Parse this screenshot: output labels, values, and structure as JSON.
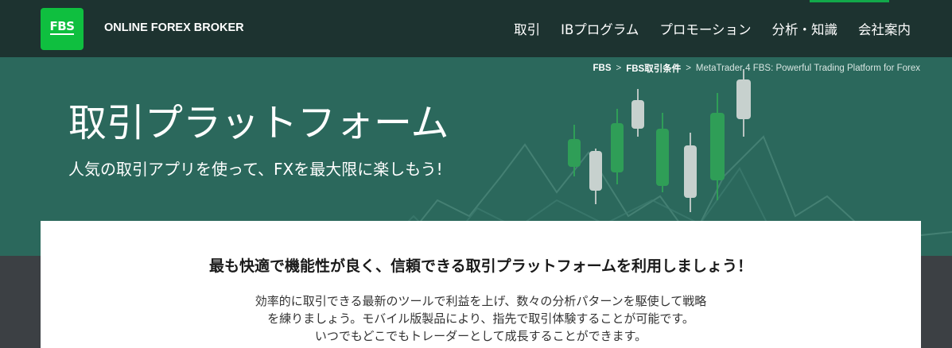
{
  "header": {
    "logo_text": "FBS",
    "brand": "ONLINE FOREX BROKER",
    "nav": [
      {
        "label": "取引"
      },
      {
        "label": "IBプログラム"
      },
      {
        "label": "プロモーション"
      },
      {
        "label": "分析・知識"
      },
      {
        "label": "会社案内"
      }
    ]
  },
  "breadcrumb": {
    "items": [
      "FBS",
      "FBS取引条件"
    ],
    "separator": ">",
    "current": "MetaTrader 4 FBS: Powerful Trading Platform for Forex"
  },
  "hero": {
    "title": "取引プラットフォーム",
    "subtitle": "人気の取引アプリを使って、FXを最大限に楽しもう!"
  },
  "card": {
    "title": "最も快適で機能性が良く、信頼できる取引プラットフォームを利用しましょう！",
    "body": [
      "効率的に取引できる最新のツールで利益を上げ、数々の分析パターンを駆使して戦略",
      "を練りましょう。モバイル版製品により、指先で取引体験することが可能です。",
      "いつでもどこでもトレーダーとして成長することができます。"
    ]
  },
  "colors": {
    "topbar": "#1d3330",
    "hero": "#2b685c",
    "logo": "#0fbf3f",
    "lower_bg": "#3c4044"
  }
}
